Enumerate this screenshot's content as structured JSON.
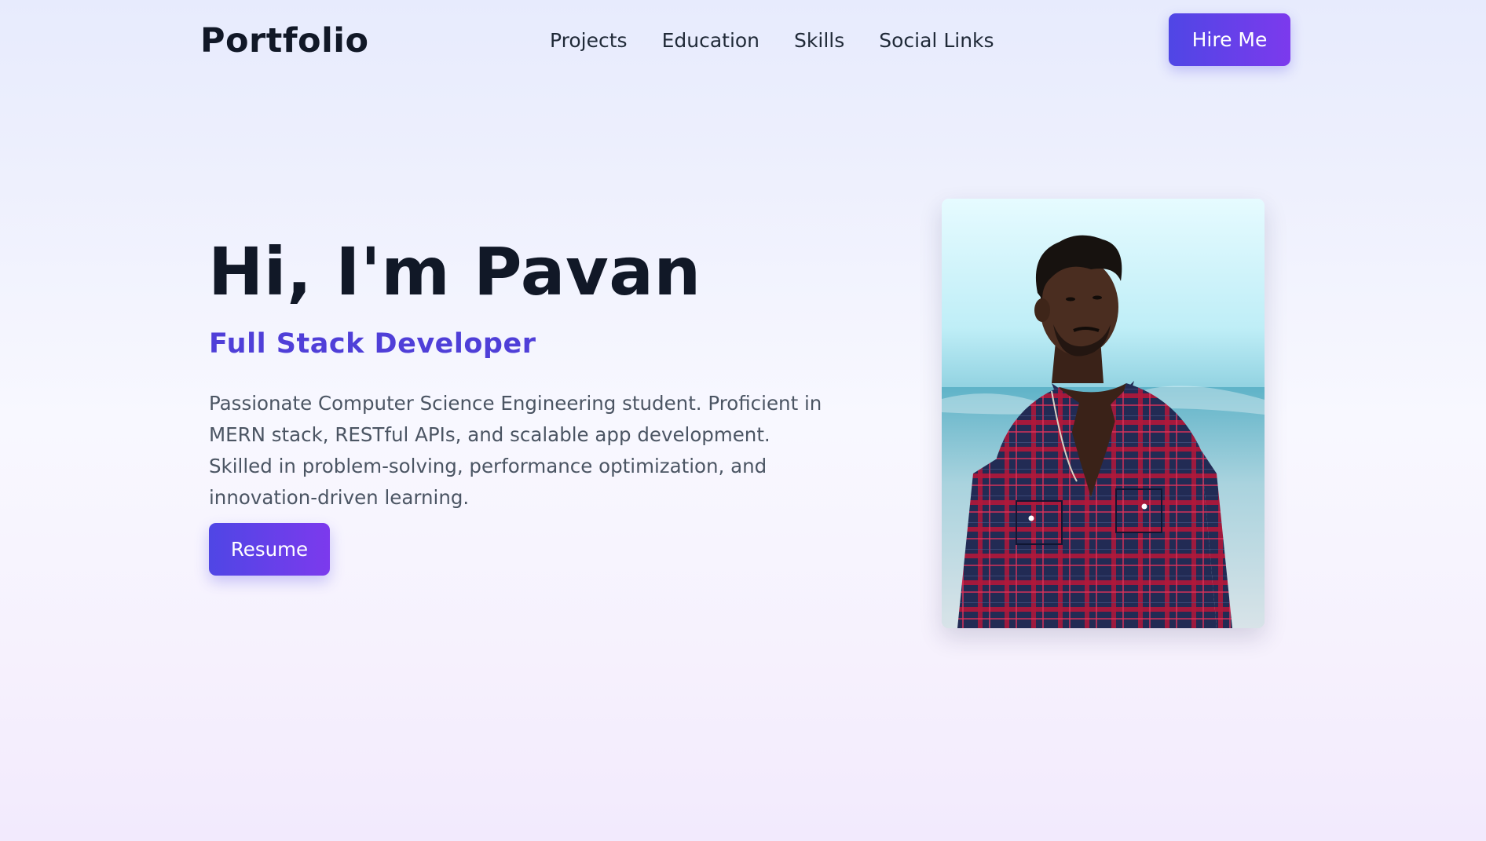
{
  "header": {
    "brand": "Portfolio",
    "nav": [
      {
        "label": "Projects"
      },
      {
        "label": "Education"
      },
      {
        "label": "Skills"
      },
      {
        "label": "Social Links"
      }
    ],
    "cta_label": "Hire Me"
  },
  "hero": {
    "title": "Hi, I'm Pavan",
    "subtitle": "Full Stack Developer",
    "description": "Passionate Computer Science Engineering student. Proficient in MERN stack, RESTful APIs, and scalable app development. Skilled in problem-solving, performance optimization, and innovation-driven learning.",
    "resume_label": "Resume"
  },
  "profile": {
    "image": "profile-photo"
  },
  "colors": {
    "accent": "#4f46e5",
    "accent_end": "#7c3aed",
    "subtitle": "#4f3fd8",
    "text_dark": "#111827",
    "text_muted": "#4b5563"
  }
}
